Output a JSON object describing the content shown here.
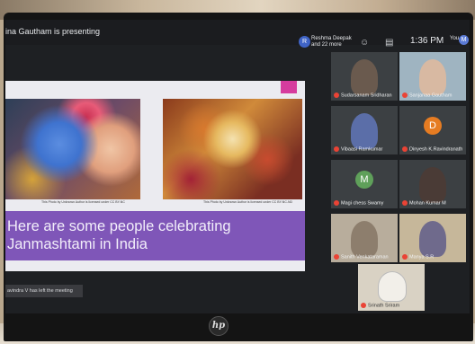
{
  "meeting": {
    "presenting_text": "ina Gautham is presenting",
    "host_initial": "R",
    "host_label": "Reshma Deepak and 22 more",
    "time": "1:36 PM",
    "you_label": "You",
    "you_initial": "M",
    "notice_text": "avindra V has left the meeting"
  },
  "slide": {
    "caption_left": "This Photo by Unknown Author is licensed under CC BY-NC",
    "caption_right": "This Photo by Unknown Author is licensed under CC BY-NC-ND",
    "heading": "Here are some people celebrating Janmashtami in India"
  },
  "participants": [
    {
      "name": "Sudarsanam Sridharan",
      "initial": "",
      "color": "#6a5a4e"
    },
    {
      "name": "Sanjanaa Gautham",
      "initial": "",
      "color": "#8da7b8"
    },
    {
      "name": "Vibaasi Ramkumar",
      "initial": "",
      "color": "#5b6ea8"
    },
    {
      "name": "Dinyesh K.Ravindranath",
      "initial": "D",
      "color": "#e67c22"
    },
    {
      "name": "Magi chess Swamy",
      "initial": "M",
      "color": "#5fa05a"
    },
    {
      "name": "Mohan Kumar M",
      "initial": "",
      "color": "#4a3b36"
    },
    {
      "name": "Sanith Venkataraman",
      "initial": "",
      "color": "#b8ad9c"
    },
    {
      "name": "Manya S.R",
      "initial": "",
      "color": "#c6b79a"
    },
    {
      "name": "Srinath Sriram",
      "initial": "",
      "color": "#d9d2c4"
    }
  ],
  "colors": {
    "banner": "#7f56b8",
    "accent": "#d63c9e",
    "meet_bg": "#1e2023"
  },
  "icons": [
    "people-icon",
    "chat-icon",
    "activities-icon",
    "mic-off-icon",
    "hp-logo"
  ],
  "device_brand": "hp"
}
